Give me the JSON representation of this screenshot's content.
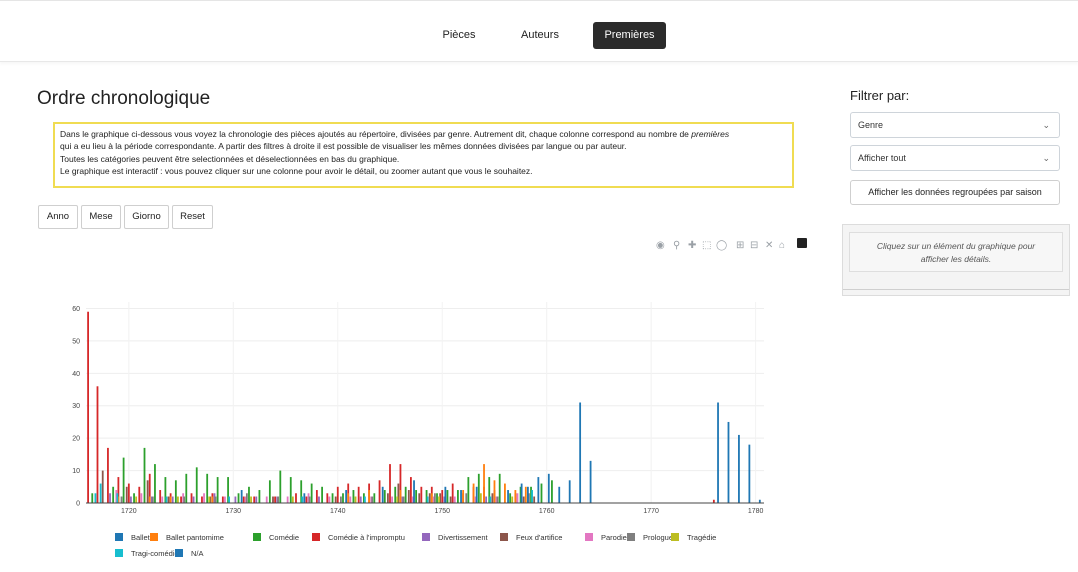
{
  "nav": {
    "items": [
      "Pièces",
      "Auteurs",
      "Premières"
    ],
    "active": "Premières"
  },
  "page": {
    "title": "Ordre chronologique"
  },
  "info": {
    "line1_a": "Dans le graphique ci-dessous vous voyez la chronologie des pièces ajoutés au répertoire, divisées par genre. Autrement dit, chaque colonne correspond au nombre de ",
    "line1_em": "premières",
    "line2": "qui a eu lieu à la période correspondante. A partir des filtres à droite il est possible de visualiser les mêmes données divisées par langue ou par auteur.",
    "line3": "Toutes les catégories peuvent être selectionnées et déselectionnées en bas du graphique.",
    "line4": "Le graphique est interactif : vous pouvez cliquer sur une colonne pour avoir le détail, ou zoomer autant que vous le souhaitez."
  },
  "zoom_buttons": [
    "Anno",
    "Mese",
    "Giorno",
    "Reset"
  ],
  "modebar_icons": [
    "camera-icon",
    "zoom-icon",
    "pan-icon",
    "box-select-icon",
    "lasso-icon",
    "zoom-in-icon",
    "zoom-out-icon",
    "autoscale-icon",
    "home-icon",
    "plotly-logo-icon"
  ],
  "sidebar": {
    "title": "Filtrer par:",
    "select1": "Genre",
    "select2": "Afficher tout",
    "group_button": "Afficher les données regroupées par saison",
    "details_text_1": "Cliquez sur un élément du graphique pour",
    "details_text_2": "afficher les détails."
  },
  "colors": {
    "Ballet": "#1f77b4",
    "Ballet pantomime": "#ff7f0e",
    "Comédie": "#2ca02c",
    "Comédie à l'impromptu": "#d62728",
    "Divertissement": "#9467bd",
    "Feux d'artifice": "#8c564b",
    "Parodie": "#e377c2",
    "Prologue": "#7f7f7f",
    "Tragédie": "#bcbd22",
    "Tragi-comédie": "#17becf",
    "N/A": "#1f77b4"
  },
  "chart_data": {
    "type": "bar",
    "xlabel": "",
    "ylabel": "",
    "xlim": [
      1715.9,
      1780.8
    ],
    "ylim": [
      0,
      62
    ],
    "x_ticks": [
      1720,
      1730,
      1740,
      1750,
      1760,
      1770,
      1780
    ],
    "y_ticks": [
      0,
      10,
      20,
      30,
      40,
      50,
      60
    ],
    "legend": [
      "Ballet",
      "Ballet pantomime",
      "Comédie",
      "Comédie à l'impromptu",
      "Divertissement",
      "Feux d'artifice",
      "Parodie",
      "Prologue",
      "Tragédie",
      "Tragi-comédie",
      "N/A"
    ],
    "legend_position": "bottom",
    "series": [
      {
        "name": "Comédie à l'impromptu",
        "points": [
          [
            1716.1,
            59
          ],
          [
            1717.0,
            36
          ],
          [
            1718.0,
            17
          ],
          [
            1719.0,
            8
          ],
          [
            1720.0,
            6
          ],
          [
            1721.0,
            5
          ],
          [
            1722.0,
            9
          ],
          [
            1723.0,
            4
          ],
          [
            1724.0,
            3
          ],
          [
            1725.0,
            2
          ],
          [
            1726.0,
            3
          ],
          [
            1727.0,
            2
          ],
          [
            1728.0,
            3
          ],
          [
            1729.0,
            2
          ],
          [
            1731.0,
            2
          ],
          [
            1732.0,
            2
          ],
          [
            1734.0,
            2
          ],
          [
            1736.0,
            3
          ],
          [
            1737.0,
            2
          ],
          [
            1738.0,
            4
          ],
          [
            1739.0,
            3
          ],
          [
            1740.0,
            5
          ],
          [
            1741.0,
            6
          ],
          [
            1742.0,
            5
          ],
          [
            1743.0,
            6
          ],
          [
            1744.0,
            7
          ],
          [
            1745.0,
            12
          ],
          [
            1746.0,
            12
          ],
          [
            1747.0,
            8
          ],
          [
            1748.0,
            5
          ],
          [
            1749.0,
            5
          ],
          [
            1750.0,
            4
          ],
          [
            1751.0,
            6
          ],
          [
            1752.0,
            3
          ],
          [
            1753.0,
            5
          ],
          [
            1754.0,
            5
          ],
          [
            1755.0,
            4
          ],
          [
            1757.0,
            3
          ],
          [
            1776.0,
            1
          ]
        ]
      },
      {
        "name": "Comédie",
        "points": [
          [
            1716.5,
            3
          ],
          [
            1718.5,
            5
          ],
          [
            1719.5,
            14
          ],
          [
            1720.5,
            3
          ],
          [
            1721.5,
            17
          ],
          [
            1722.5,
            12
          ],
          [
            1723.5,
            8
          ],
          [
            1724.5,
            7
          ],
          [
            1725.5,
            9
          ],
          [
            1726.5,
            11
          ],
          [
            1727.5,
            9
          ],
          [
            1728.5,
            8
          ],
          [
            1729.5,
            8
          ],
          [
            1730.5,
            3
          ],
          [
            1731.5,
            5
          ],
          [
            1732.5,
            4
          ],
          [
            1733.5,
            7
          ],
          [
            1734.5,
            10
          ],
          [
            1735.5,
            8
          ],
          [
            1736.5,
            7
          ],
          [
            1737.5,
            6
          ],
          [
            1738.5,
            5
          ],
          [
            1739.5,
            3
          ],
          [
            1740.5,
            3
          ],
          [
            1741.5,
            4
          ],
          [
            1742.5,
            3
          ],
          [
            1743.5,
            3
          ],
          [
            1744.5,
            4
          ],
          [
            1745.5,
            5
          ],
          [
            1746.5,
            5
          ],
          [
            1747.5,
            4
          ],
          [
            1748.5,
            4
          ],
          [
            1749.5,
            3
          ],
          [
            1750.5,
            4
          ],
          [
            1751.5,
            4
          ],
          [
            1752.5,
            8
          ],
          [
            1753.5,
            9
          ],
          [
            1754.5,
            8
          ],
          [
            1755.5,
            9
          ],
          [
            1756.5,
            3
          ],
          [
            1757.5,
            5
          ],
          [
            1758.5,
            5
          ],
          [
            1759.5,
            6
          ],
          [
            1760.5,
            7
          ]
        ]
      },
      {
        "name": "Ballet pantomime",
        "points": [
          [
            1719.0,
            2
          ],
          [
            1722.0,
            2
          ],
          [
            1724.0,
            2
          ],
          [
            1728.0,
            2
          ],
          [
            1741.0,
            3
          ],
          [
            1743.0,
            4
          ],
          [
            1746.0,
            4
          ],
          [
            1749.0,
            3
          ],
          [
            1752.0,
            4
          ],
          [
            1753.0,
            6
          ],
          [
            1754.0,
            12
          ],
          [
            1755.0,
            7
          ],
          [
            1756.0,
            6
          ],
          [
            1757.0,
            4
          ],
          [
            1758.0,
            5
          ]
        ]
      },
      {
        "name": "Feux d'artifice",
        "points": [
          [
            1717.5,
            10
          ],
          [
            1719.8,
            5
          ],
          [
            1721.8,
            7
          ],
          [
            1723.8,
            2
          ],
          [
            1727.8,
            2
          ],
          [
            1733.8,
            2
          ],
          [
            1739.8,
            2
          ],
          [
            1744.8,
            3
          ],
          [
            1745.8,
            6
          ],
          [
            1746.8,
            4
          ],
          [
            1747.8,
            3
          ],
          [
            1748.8,
            3
          ],
          [
            1749.8,
            3
          ],
          [
            1750.8,
            2
          ],
          [
            1754.8,
            3
          ],
          [
            1757.8,
            2
          ],
          [
            1758.8,
            2
          ]
        ]
      },
      {
        "name": "Divertissement",
        "points": [
          [
            1718.2,
            3
          ],
          [
            1720.2,
            2
          ],
          [
            1722.2,
            2
          ],
          [
            1724.2,
            2
          ],
          [
            1726.2,
            2
          ],
          [
            1728.2,
            3
          ],
          [
            1730.2,
            2
          ],
          [
            1732.2,
            2
          ],
          [
            1734.2,
            2
          ],
          [
            1738.2,
            2
          ],
          [
            1742.2,
            2
          ],
          [
            1746.2,
            2
          ],
          [
            1750.2,
            2
          ],
          [
            1754.2,
            2
          ]
        ]
      },
      {
        "name": "Parodie",
        "points": [
          [
            1718.8,
            4
          ],
          [
            1721.2,
            3
          ],
          [
            1723.2,
            2
          ],
          [
            1725.2,
            3
          ],
          [
            1727.2,
            3
          ],
          [
            1729.2,
            2
          ],
          [
            1731.2,
            2
          ],
          [
            1733.2,
            2
          ],
          [
            1735.2,
            2
          ],
          [
            1737.2,
            3
          ],
          [
            1739.2,
            2
          ],
          [
            1741.2,
            2
          ],
          [
            1743.2,
            2
          ],
          [
            1745.2,
            2
          ],
          [
            1747.2,
            2
          ],
          [
            1749.2,
            2
          ],
          [
            1751.2,
            2
          ],
          [
            1753.2,
            2
          ],
          [
            1755.2,
            2
          ],
          [
            1757.2,
            3
          ]
        ]
      },
      {
        "name": "Prologue",
        "points": [
          [
            1719.3,
            2
          ],
          [
            1722.3,
            2
          ],
          [
            1725.3,
            2
          ],
          [
            1728.3,
            2
          ],
          [
            1731.3,
            3
          ],
          [
            1734.3,
            2
          ],
          [
            1737.3,
            2
          ],
          [
            1740.3,
            2
          ],
          [
            1743.3,
            2
          ],
          [
            1746.3,
            2
          ],
          [
            1749.3,
            3
          ],
          [
            1752.3,
            3
          ],
          [
            1755.3,
            2
          ],
          [
            1758.3,
            3
          ]
        ]
      },
      {
        "name": "Tragédie",
        "points": [
          [
            1720.7,
            2
          ],
          [
            1724.7,
            2
          ],
          [
            1727.7,
            2
          ],
          [
            1731.7,
            2
          ],
          [
            1735.7,
            2
          ],
          [
            1741.7,
            2
          ],
          [
            1745.7,
            2
          ],
          [
            1749.7,
            2
          ],
          [
            1753.7,
            3
          ],
          [
            1756.7,
            2
          ]
        ]
      },
      {
        "name": "Tragi-comédie",
        "points": [
          [
            1716.8,
            3
          ],
          [
            1717.3,
            6
          ],
          [
            1718.9,
            3
          ],
          [
            1723.6,
            2
          ],
          [
            1729.6,
            2
          ],
          [
            1736.6,
            2
          ],
          [
            1742.6,
            2
          ],
          [
            1748.6,
            2
          ],
          [
            1754.6,
            2
          ],
          [
            1758.6,
            4
          ]
        ]
      },
      {
        "name": "Ballet",
        "points": [
          [
            1730.8,
            4
          ],
          [
            1736.8,
            3
          ],
          [
            1740.8,
            4
          ],
          [
            1744.3,
            5
          ],
          [
            1747.3,
            7
          ],
          [
            1750.3,
            5
          ],
          [
            1751.8,
            4
          ],
          [
            1753.3,
            5
          ],
          [
            1756.3,
            4
          ],
          [
            1757.6,
            6
          ],
          [
            1758.2,
            5
          ],
          [
            1759.2,
            8
          ],
          [
            1760.2,
            9
          ],
          [
            1761.2,
            5
          ],
          [
            1762.2,
            7
          ],
          [
            1763.2,
            31
          ],
          [
            1764.2,
            13
          ],
          [
            1776.4,
            31
          ],
          [
            1777.4,
            25
          ],
          [
            1778.4,
            21
          ],
          [
            1779.4,
            18
          ],
          [
            1780.4,
            1
          ]
        ]
      }
    ]
  }
}
